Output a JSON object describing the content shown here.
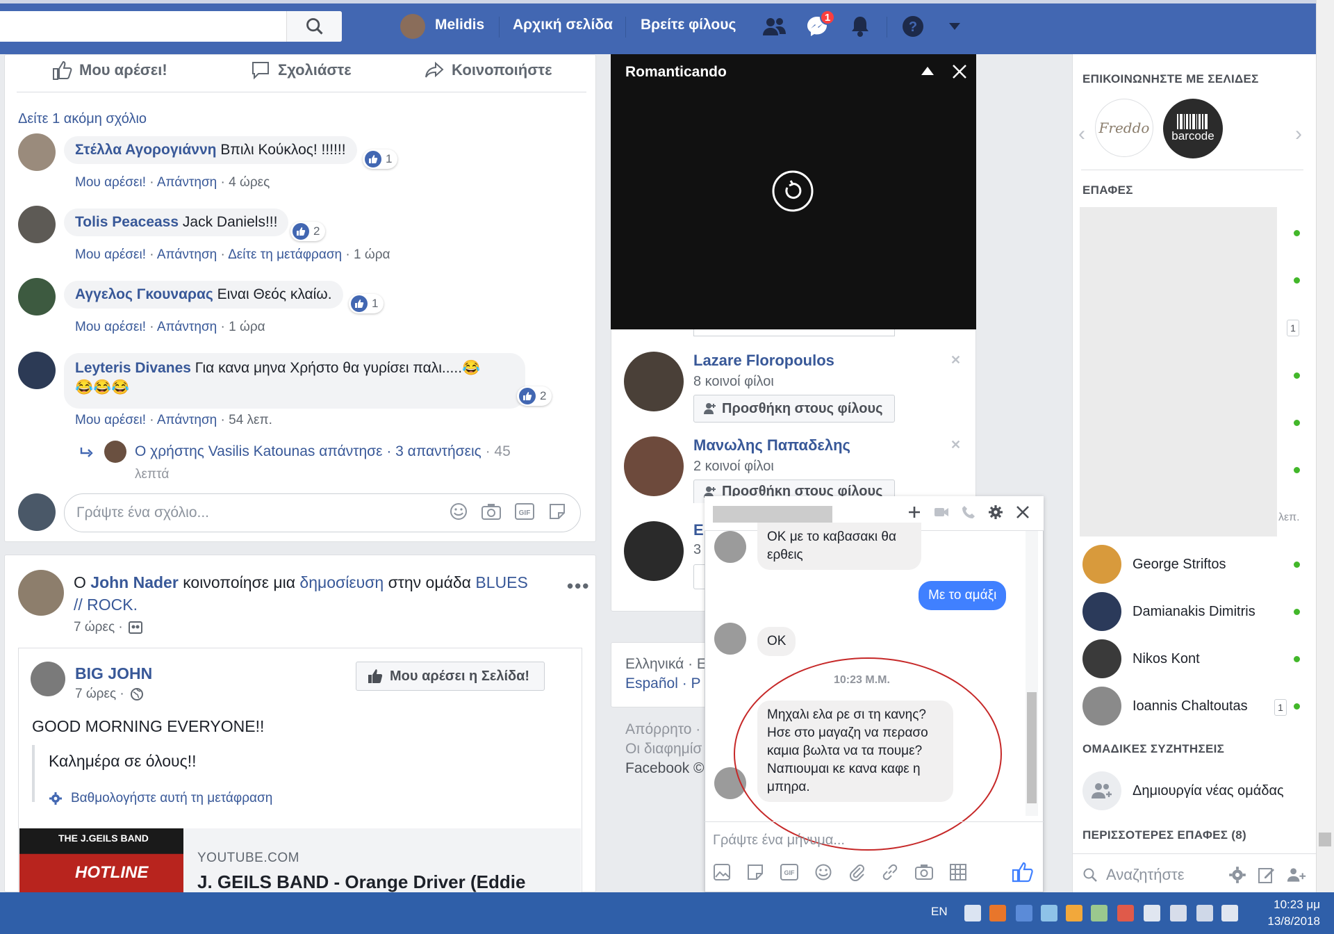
{
  "topbar": {
    "user_name": "Melidis",
    "home": "Αρχική σελίδα",
    "find_friends": "Βρείτε φίλους",
    "messages_badge": "1"
  },
  "post_actions": {
    "like": "Μου αρέσει!",
    "comment": "Σχολιάστε",
    "share": "Κοινοποιήστε"
  },
  "comments": {
    "view_more": "Δείτε 1 ακόμη σχόλιο",
    "items": [
      {
        "author": "Στέλλα Αγορογιάννη",
        "text": "Βπιλι Κούκλος! !!!!!!",
        "likes": "1",
        "like_label": "Μου αρέσει!",
        "reply_label": "Απάντηση",
        "time": "4 ώρες"
      },
      {
        "author": "Tolis Peaceass",
        "text": "Jack Daniels!!!",
        "likes": "2",
        "like_label": "Μου αρέσει!",
        "reply_label": "Απάντηση",
        "translate": "Δείτε τη μετάφραση",
        "time": "1 ώρα"
      },
      {
        "author": "Αγγελος Γκουναρας",
        "text": "Ειναι Θεός κλαίω.",
        "likes": "1",
        "like_label": "Μου αρέσει!",
        "reply_label": "Απάντηση",
        "time": "1 ώρα"
      },
      {
        "author": "Leyteris Divanes",
        "text": "Για κανα μηνα Χρήστο θα γυρίσει παλι.....😂",
        "text2": "😂😂😂",
        "likes": "2",
        "like_label": "Μου αρέσει!",
        "reply_label": "Απάντηση",
        "time": "54 λεπ."
      }
    ],
    "reply_thread": {
      "text": "Ο χρήστης Vasilis Katounas απάντησε · 3 απαντήσεις",
      "time1": " · 45",
      "time2": "λεπτά"
    },
    "write_placeholder": "Γράψτε ένα σχόλιο..."
  },
  "post2": {
    "prefix": "Ο ",
    "author": "John Nader",
    "mid": " κοινοποίησε μια ",
    "link1": "δημοσίευση",
    "mid2": " στην ομάδα ",
    "group1": "BLUES",
    "group2": "// ROCK.",
    "time": "7 ώρες ·",
    "inner": {
      "page": "BIG JOHN",
      "time": "7 ώρες ·",
      "like_page": "Μου αρέσει η Σελίδα!",
      "text": "GOOD MORNING EVERYONE!!",
      "translation": "Καλημέρα σε όλους!!",
      "rate": "Βαθμολογήστε αυτή τη μετάφραση",
      "link_domain": "YOUTUBE.COM",
      "link_title": "J. GEILS BAND - Orange Driver (Eddie",
      "thumb_band": "THE J.GEILS BAND",
      "thumb_word": "HOTLINE"
    }
  },
  "video": {
    "title": "Romanticando"
  },
  "suggestions": {
    "items": [
      {
        "name": "Lazare Floropoulos",
        "mutual": "8 κοινοί φίλοι",
        "add": "Προσθήκη στους φίλους"
      },
      {
        "name": "Μανωλης Παπαδελης",
        "mutual": "2 κοινοί φίλοι",
        "add": "Προσθήκη στους φίλους"
      },
      {
        "name": "E",
        "mutual": "3"
      }
    ]
  },
  "footer": {
    "langs1": "Ελληνικά · E",
    "langs2": "Español · P",
    "privacy": "Απόρρητο ·",
    "ads": "Οι διαφημίσ",
    "fb": "Facebook ©"
  },
  "chat": {
    "messages": [
      {
        "from": "them",
        "text": "ΟΚ με το καβασακι θα ερθεις"
      },
      {
        "from": "me",
        "text": "Με το αμάξι"
      },
      {
        "from": "them",
        "text": "OK"
      }
    ],
    "timestamp": "10:23 Μ.Μ.",
    "last": [
      "Μηχαλι ελα ρε σι τη κανης?",
      "Ησε στο μαγαζη να περασο",
      "καμια βωλτα να τα πουμε?",
      "Ναπιουμαι κε κανα καφε η",
      "μπηρα."
    ],
    "input_placeholder": "Γράψτε ένα μήνυμα..."
  },
  "sidebar": {
    "pages_heading": "ΕΠΙΚΟΙΝΩΝΗΣΤΕ ΜΕ ΣΕΛΙΔΕΣ",
    "page1": "Freddo",
    "page2": "barcode",
    "contacts_heading": "ΕΠΑΦΕΣ",
    "badge_1": "1",
    "minutes": "λεπ.",
    "contacts": [
      {
        "name": "George Striftos"
      },
      {
        "name": "Damianakis Dimitris"
      },
      {
        "name": "Nikos Kont"
      },
      {
        "name": "Ioannis Chaltoutas",
        "badge": "1"
      }
    ],
    "groups_heading": "ΟΜΑΔΙΚΕΣ ΣΥΖΗΤΗΣΕΙΣ",
    "create_group": "Δημιουργία νέας ομάδας",
    "more_contacts": "ΠΕΡΙΣΣΟΤΕΡΕΣ ΕΠΑΦΕΣ (8)",
    "search_placeholder": "Αναζητήστε"
  },
  "taskbar": {
    "lang": "EN",
    "time": "10:23 μμ",
    "date": "13/8/2018"
  }
}
